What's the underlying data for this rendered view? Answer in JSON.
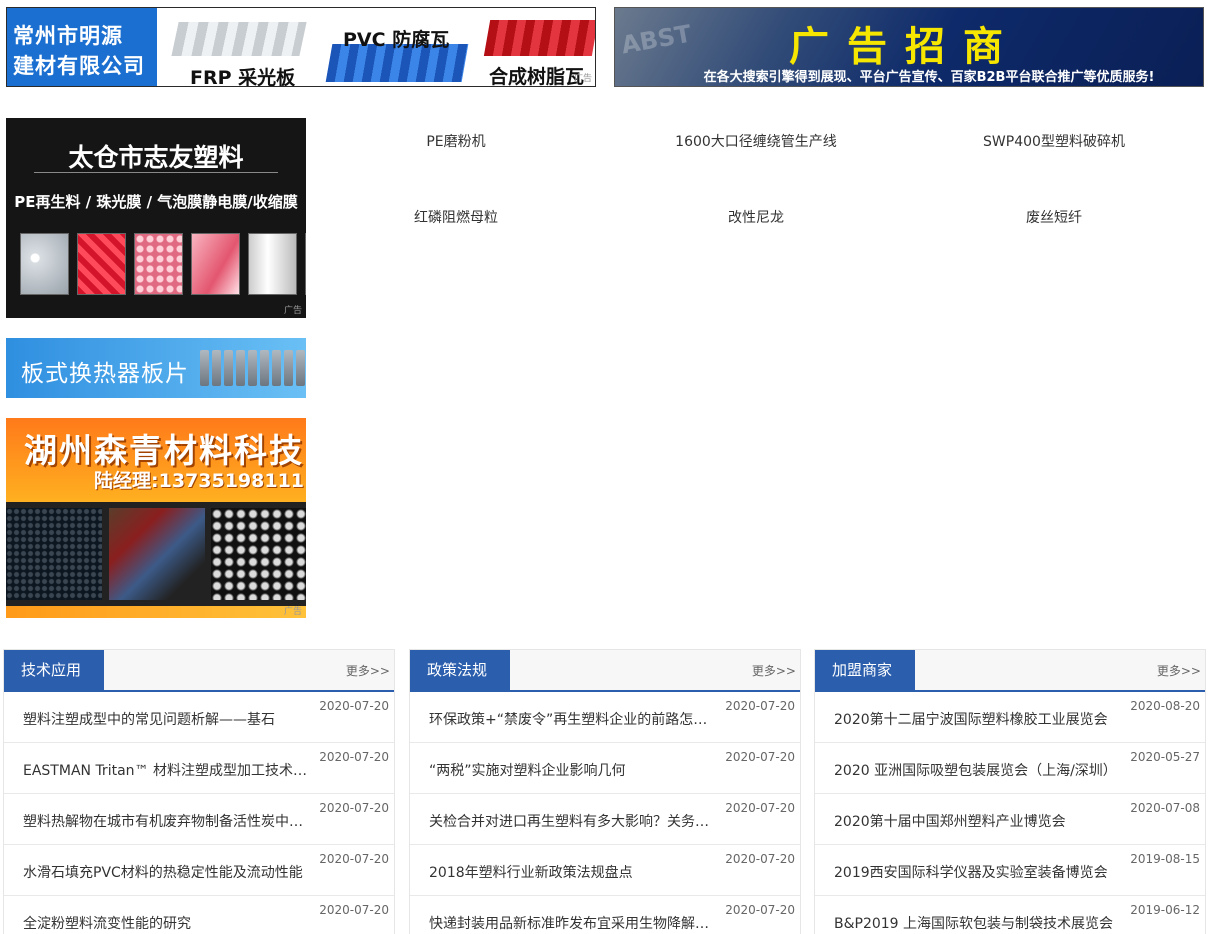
{
  "banners": {
    "top_left": {
      "company": [
        "常州市明源",
        "建材有限公司"
      ],
      "product_1": "FRP 采光板",
      "product_2": "PVC 防腐瓦",
      "product_3": "合成树脂瓦",
      "ad_tag": "广告"
    },
    "top_right": {
      "headline": "广告招商",
      "subtitle": "在各大搜索引擎得到展现、平台广告宣传、百家B2B平台联合推广等优质服务!"
    }
  },
  "side_ads": {
    "ad1": {
      "title": "太仓市志友塑料",
      "subtitle": "PE再生料 / 珠光膜 / 气泡膜静电膜/收缩膜",
      "ad_tag": "广告"
    },
    "ad2": {
      "title": "板式换热器板片"
    },
    "ad3": {
      "title": "湖州森青材料科技",
      "phone": "陆经理:13735198111",
      "ad_tag": "广告"
    }
  },
  "keywords": [
    "PE磨粉机",
    "1600大口径缠绕管生产线",
    "SWP400型塑料破碎机",
    "红磷阻燃母粒",
    "改性尼龙",
    "废丝短纤"
  ],
  "panels": [
    {
      "tab": "技术应用",
      "more": "更多>>",
      "items": [
        {
          "title": "塑料注塑成型中的常见问题析解——基石",
          "date": "2020-07-20"
        },
        {
          "title": "EASTMAN Tritan™ 材料注塑成型加工技术指南",
          "date": "2020-07-20"
        },
        {
          "title": "塑料热解物在城市有机废弃物制备活性炭中的应用",
          "date": "2020-07-20"
        },
        {
          "title": "水滑石填充PVC材料的热稳定性能及流动性能",
          "date": "2020-07-20"
        },
        {
          "title": "全淀粉塑料流变性能的研究",
          "date": "2020-07-20"
        }
      ]
    },
    {
      "tab": "政策法规",
      "more": "更多>>",
      "items": [
        {
          "title": "环保政策+“禁废令”再生塑料企业的前路怎么走",
          "date": "2020-07-20"
        },
        {
          "title": "“两税”实施对塑料企业影响几何",
          "date": "2020-07-20"
        },
        {
          "title": "关检合并对进口再生塑料有多大影响？关务人员解读",
          "date": "2020-07-20"
        },
        {
          "title": "2018年塑料行业新政策法规盘点",
          "date": "2020-07-20"
        },
        {
          "title": "快递封装用品新标准昨发布宜采用生物降解塑料",
          "date": "2020-07-20"
        }
      ]
    },
    {
      "tab": "加盟商家",
      "more": "更多>>",
      "items": [
        {
          "title": "2020第十二届宁波国际塑料橡胶工业展览会",
          "date": "2020-08-20"
        },
        {
          "title": "2020 亚洲国际吸塑包装展览会（上海/深圳）",
          "date": "2020-05-27"
        },
        {
          "title": "2020第十届中国郑州塑料产业博览会",
          "date": "2020-07-08"
        },
        {
          "title": "2019西安国际科学仪器及实验室装备博览会",
          "date": "2019-08-15"
        },
        {
          "title": "B&P2019 上海国际软包装与制袋技术展览会",
          "date": "2019-06-12"
        }
      ]
    }
  ]
}
